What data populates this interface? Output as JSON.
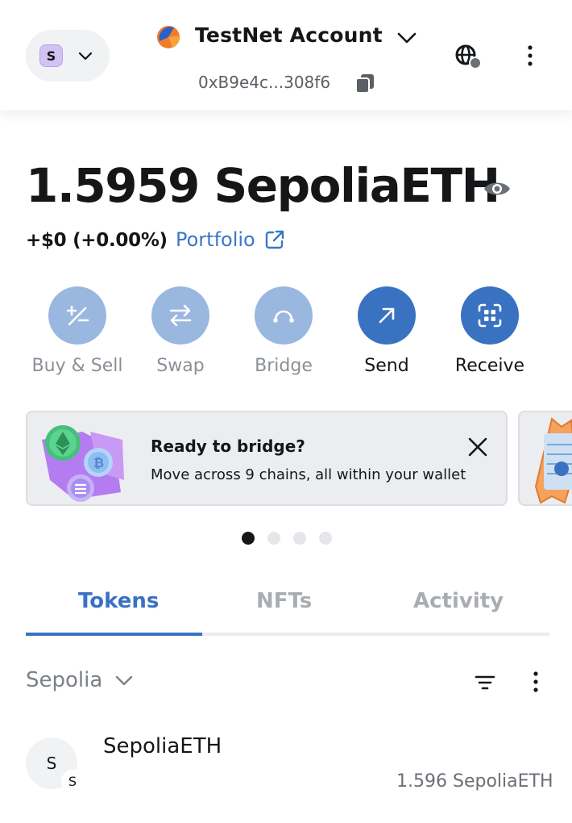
{
  "header": {
    "network_avatar": "S",
    "account_name": "TestNet Account",
    "account_address": "0xB9e4c...308f6"
  },
  "balance": {
    "amount": "1.5959 SepoliaETH",
    "change": "+$0 (+0.00%)",
    "portfolio_link": "Portfolio"
  },
  "actions": [
    {
      "label": "Buy & Sell",
      "icon": "plus-minus-icon",
      "enabled": false
    },
    {
      "label": "Swap",
      "icon": "swap-arrows-icon",
      "enabled": false
    },
    {
      "label": "Bridge",
      "icon": "bridge-icon",
      "enabled": false
    },
    {
      "label": "Send",
      "icon": "arrow-up-right-icon",
      "enabled": true
    },
    {
      "label": "Receive",
      "icon": "qr-scan-icon",
      "enabled": true
    }
  ],
  "banner": {
    "title": "Ready to bridge?",
    "subtitle": "Move across 9 chains, all within your wallet"
  },
  "carousel": {
    "total": 4,
    "active": 1
  },
  "tabs": [
    {
      "label": "Tokens",
      "active": true
    },
    {
      "label": "NFTs",
      "active": false
    },
    {
      "label": "Activity",
      "active": false
    }
  ],
  "filter": {
    "network": "Sepolia"
  },
  "tokens": [
    {
      "avatar": "S",
      "badge": "S",
      "name": "SepoliaETH",
      "balance": "1.596 SepoliaETH"
    }
  ],
  "colors": {
    "accent": "#3a72c2",
    "accent_disabled": "#9ab7e0",
    "text": "#141618"
  }
}
